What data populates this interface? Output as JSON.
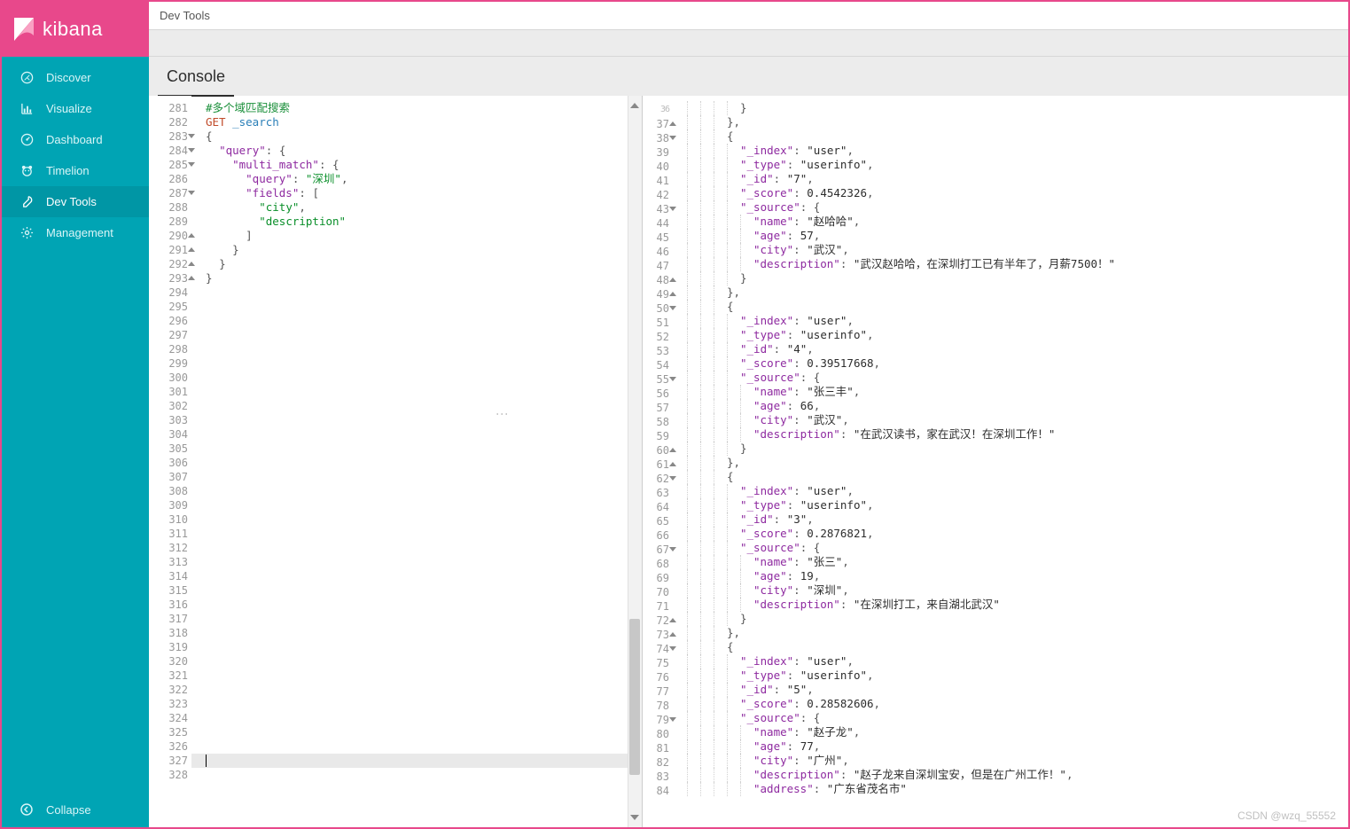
{
  "brand": {
    "name": "kibana"
  },
  "sidebar": {
    "items": [
      {
        "label": "Discover",
        "icon": "compass"
      },
      {
        "label": "Visualize",
        "icon": "bar-chart"
      },
      {
        "label": "Dashboard",
        "icon": "gauge"
      },
      {
        "label": "Timelion",
        "icon": "bear"
      },
      {
        "label": "Dev Tools",
        "icon": "wrench",
        "active": true
      },
      {
        "label": "Management",
        "icon": "gear"
      }
    ],
    "collapse_label": "Collapse"
  },
  "breadcrumb": "Dev Tools",
  "tabs": [
    {
      "label": "Console",
      "active": true
    }
  ],
  "editor": {
    "first_line": 281,
    "last_line": 328,
    "cursor_line": 327,
    "lines": [
      {
        "n": 281,
        "t": "comment",
        "text": "#多个域匹配搜索"
      },
      {
        "n": 282,
        "t": "req",
        "method": "GET",
        "path": "_search"
      },
      {
        "n": 283,
        "t": "punc",
        "text": "{",
        "fold": "open"
      },
      {
        "n": 284,
        "t": "kv",
        "indent": 1,
        "key": "query",
        "val_type": "obj_open",
        "fold": "open"
      },
      {
        "n": 285,
        "t": "kv",
        "indent": 2,
        "key": "multi_match",
        "val_type": "obj_open",
        "fold": "open"
      },
      {
        "n": 286,
        "t": "kv",
        "indent": 3,
        "key": "query",
        "val_type": "str",
        "val": "深圳",
        "comma": true
      },
      {
        "n": 287,
        "t": "kv",
        "indent": 3,
        "key": "fields",
        "val_type": "arr_open",
        "fold": "open"
      },
      {
        "n": 288,
        "t": "arr_item",
        "indent": 4,
        "val": "city",
        "comma": true
      },
      {
        "n": 289,
        "t": "arr_item",
        "indent": 4,
        "val": "description"
      },
      {
        "n": 290,
        "t": "close",
        "indent": 3,
        "text": "]",
        "fold": "up"
      },
      {
        "n": 291,
        "t": "close",
        "indent": 2,
        "text": "}",
        "fold": "up"
      },
      {
        "n": 292,
        "t": "close",
        "indent": 1,
        "text": "}",
        "fold": "up"
      },
      {
        "n": 293,
        "t": "close",
        "indent": 0,
        "text": "}",
        "fold": "up"
      }
    ]
  },
  "response": {
    "first_line": 36,
    "last_line": 84,
    "lines": [
      {
        "n": 36,
        "fold": "end",
        "raw": "        }"
      },
      {
        "n": 37,
        "fold": "up",
        "raw": "      },"
      },
      {
        "n": 38,
        "fold": "open",
        "raw": "      {"
      },
      {
        "n": 39,
        "raw": "        \"_index\": \"user\","
      },
      {
        "n": 40,
        "raw": "        \"_type\": \"userinfo\","
      },
      {
        "n": 41,
        "raw": "        \"_id\": \"7\","
      },
      {
        "n": 42,
        "raw": "        \"_score\": 0.4542326,"
      },
      {
        "n": 43,
        "fold": "open",
        "raw": "        \"_source\": {"
      },
      {
        "n": 44,
        "raw": "          \"name\": \"赵哈哈\","
      },
      {
        "n": 45,
        "raw": "          \"age\": 57,"
      },
      {
        "n": 46,
        "raw": "          \"city\": \"武汉\","
      },
      {
        "n": 47,
        "raw": "          \"description\": \"武汉赵哈哈，在深圳打工已有半年了，月薪7500！\""
      },
      {
        "n": 48,
        "fold": "up",
        "raw": "        }"
      },
      {
        "n": 49,
        "fold": "up",
        "raw": "      },"
      },
      {
        "n": 50,
        "fold": "open",
        "raw": "      {"
      },
      {
        "n": 51,
        "raw": "        \"_index\": \"user\","
      },
      {
        "n": 52,
        "raw": "        \"_type\": \"userinfo\","
      },
      {
        "n": 53,
        "raw": "        \"_id\": \"4\","
      },
      {
        "n": 54,
        "raw": "        \"_score\": 0.39517668,"
      },
      {
        "n": 55,
        "fold": "open",
        "raw": "        \"_source\": {"
      },
      {
        "n": 56,
        "raw": "          \"name\": \"张三丰\","
      },
      {
        "n": 57,
        "raw": "          \"age\": 66,"
      },
      {
        "n": 58,
        "raw": "          \"city\": \"武汉\","
      },
      {
        "n": 59,
        "raw": "          \"description\": \"在武汉读书，家在武汉！在深圳工作！\""
      },
      {
        "n": 60,
        "fold": "up",
        "raw": "        }"
      },
      {
        "n": 61,
        "fold": "up",
        "raw": "      },"
      },
      {
        "n": 62,
        "fold": "open",
        "raw": "      {"
      },
      {
        "n": 63,
        "raw": "        \"_index\": \"user\","
      },
      {
        "n": 64,
        "raw": "        \"_type\": \"userinfo\","
      },
      {
        "n": 65,
        "raw": "        \"_id\": \"3\","
      },
      {
        "n": 66,
        "raw": "        \"_score\": 0.2876821,"
      },
      {
        "n": 67,
        "fold": "open",
        "raw": "        \"_source\": {"
      },
      {
        "n": 68,
        "raw": "          \"name\": \"张三\","
      },
      {
        "n": 69,
        "raw": "          \"age\": 19,"
      },
      {
        "n": 70,
        "raw": "          \"city\": \"深圳\","
      },
      {
        "n": 71,
        "raw": "          \"description\": \"在深圳打工，来自湖北武汉\""
      },
      {
        "n": 72,
        "fold": "up",
        "raw": "        }"
      },
      {
        "n": 73,
        "fold": "up",
        "raw": "      },"
      },
      {
        "n": 74,
        "fold": "open",
        "raw": "      {"
      },
      {
        "n": 75,
        "raw": "        \"_index\": \"user\","
      },
      {
        "n": 76,
        "raw": "        \"_type\": \"userinfo\","
      },
      {
        "n": 77,
        "raw": "        \"_id\": \"5\","
      },
      {
        "n": 78,
        "raw": "        \"_score\": 0.28582606,"
      },
      {
        "n": 79,
        "fold": "open",
        "raw": "        \"_source\": {"
      },
      {
        "n": 80,
        "raw": "          \"name\": \"赵子龙\","
      },
      {
        "n": 81,
        "raw": "          \"age\": 77,"
      },
      {
        "n": 82,
        "raw": "          \"city\": \"广州\","
      },
      {
        "n": 83,
        "raw": "          \"description\": \"赵子龙来自深圳宝安，但是在广州工作！\","
      },
      {
        "n": 84,
        "raw": "          \"address\": \"广东省茂名市\""
      }
    ]
  },
  "watermark": "CSDN @wzq_55552"
}
